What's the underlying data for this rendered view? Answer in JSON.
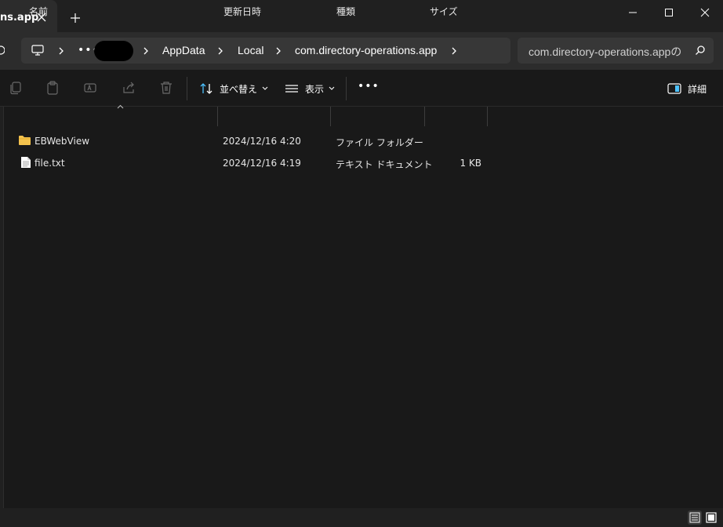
{
  "tab": {
    "title": "ns.app"
  },
  "window_controls": [
    "minimize-icon",
    "maximize-icon",
    "close-icon"
  ],
  "breadcrumb": {
    "items": [
      "AppData",
      "Local",
      "com.directory-operations.app"
    ],
    "overflow": "•••"
  },
  "search": {
    "placeholder": "com.directory-operations.appの"
  },
  "toolbar": {
    "sort_label": "並べ替え",
    "view_label": "表示",
    "more_label": "•••",
    "details_label": "詳細"
  },
  "columns": {
    "name": "名前",
    "modified": "更新日時",
    "type": "種類",
    "size": "サイズ"
  },
  "files": [
    {
      "name": "EBWebView",
      "modified": "2024/12/16 4:20",
      "type": "ファイル フォルダー",
      "size": "",
      "icon": "folder-icon"
    },
    {
      "name": "file.txt",
      "modified": "2024/12/16 4:19",
      "type": "テキスト ドキュメント",
      "size": "1 KB",
      "icon": "text-file-icon"
    }
  ],
  "colors": {
    "folder": "#f4c24d",
    "accent": "#4cc2ff",
    "background": "#191919"
  }
}
